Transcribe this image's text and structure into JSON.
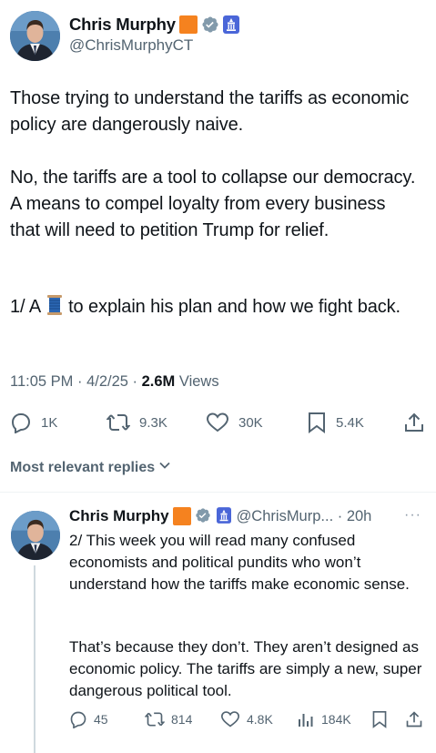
{
  "main_tweet": {
    "author_name": "Chris Murphy",
    "handle": "@ChrisMurphyCT",
    "paragraphs": [
      "Those trying to understand the tariffs as economic policy are dangerously naive.",
      "No, the tariffs are a tool to collapse our democracy. A means to compel loyalty from every business that will need to petition Trump for relief."
    ],
    "para3_prefix": "1/ A",
    "para3_suffix": "to explain his plan and how we fight back.",
    "time": "11:05 PM · 4/2/25 · ",
    "views_count": "2.6M",
    "views_label": " Views",
    "actions": {
      "replies": "1K",
      "reposts": "9.3K",
      "likes": "30K",
      "bookmarks": "5.4K"
    }
  },
  "replies_filter": "Most relevant replies",
  "reply": {
    "author_name": "Chris Murphy",
    "handle_time": "@ChrisMurp... · 20h",
    "more": "···",
    "paragraphs": [
      "2/ This week you will read many confused economists and political pundits who won’t understand how the tariffs make economic sense.",
      "That’s because they don’t. They aren’t designed as economic policy. The tariffs are simply a new, super dangerous political tool."
    ],
    "actions": {
      "replies": "45",
      "reposts": "814",
      "likes": "4.8K",
      "views": "184K"
    }
  },
  "colors": {
    "text": "#0f1419",
    "secondary": "#536471",
    "badge_orange": "#f5821f",
    "verified_gray": "#829aab",
    "gov_blue": "#4a66d8"
  },
  "icons": [
    "reply-icon",
    "repost-icon",
    "like-icon",
    "bookmark-icon",
    "share-icon",
    "views-icon",
    "spool-emoji",
    "verified-icon",
    "government-badge-icon",
    "chevron-down-icon"
  ]
}
